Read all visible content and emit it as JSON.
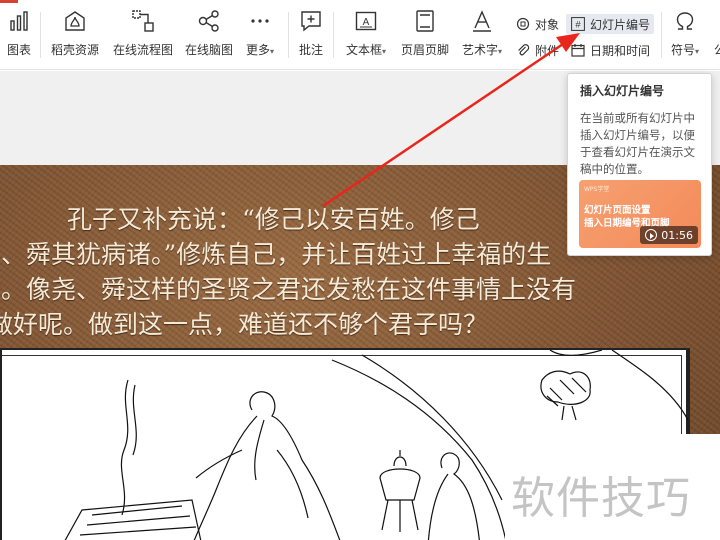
{
  "ribbon": {
    "chart_label": "图表",
    "daoke_label": "稻壳资源",
    "flowchart_label": "在线流程图",
    "mindmap_label": "在线脑图",
    "more_label": "更多",
    "comment_label": "批注",
    "textbox_label": "文本框",
    "header_footer_label": "页眉页脚",
    "wordart_label": "艺术字",
    "object_label": "对象",
    "slide_number_label": "幻灯片编号",
    "attach_label": "附件",
    "datetime_label": "日期和时间",
    "symbol_label": "符号",
    "formula_label": "公"
  },
  "tooltip": {
    "title": "插入幻灯片编号",
    "description": "在当前或所有幻灯片中插入幻灯片编号，以便于查看幻灯片在演示文稿中的位置。",
    "thumb_brand": "WPS学堂",
    "thumb_line1": "幻灯片页面设置",
    "thumb_line2": "插入日期编号和页脚",
    "duration": "01:56"
  },
  "slide": {
    "line1": "孔子又补充说：“修己以安百姓。修己",
    "line2": "舜其犹病诸。”修炼自己，并让百姓过上幸福的生",
    "line3": "像尧、舜这样的圣贤之君还发愁在这件事情上没有",
    "line4": "好呢。做到这一点，难道还不够个君子吗？",
    "line2_lead": "尧、",
    "line3_lead": "活。",
    "line4_lead": "做"
  },
  "watermark": "软件技巧",
  "colors": {
    "slide_bg": "#7e5230",
    "slide_text": "#f4ead8",
    "arrow": "#e8261c",
    "thumb": "#f48a5a",
    "ribbon_highlight": "#e6eaf0"
  }
}
